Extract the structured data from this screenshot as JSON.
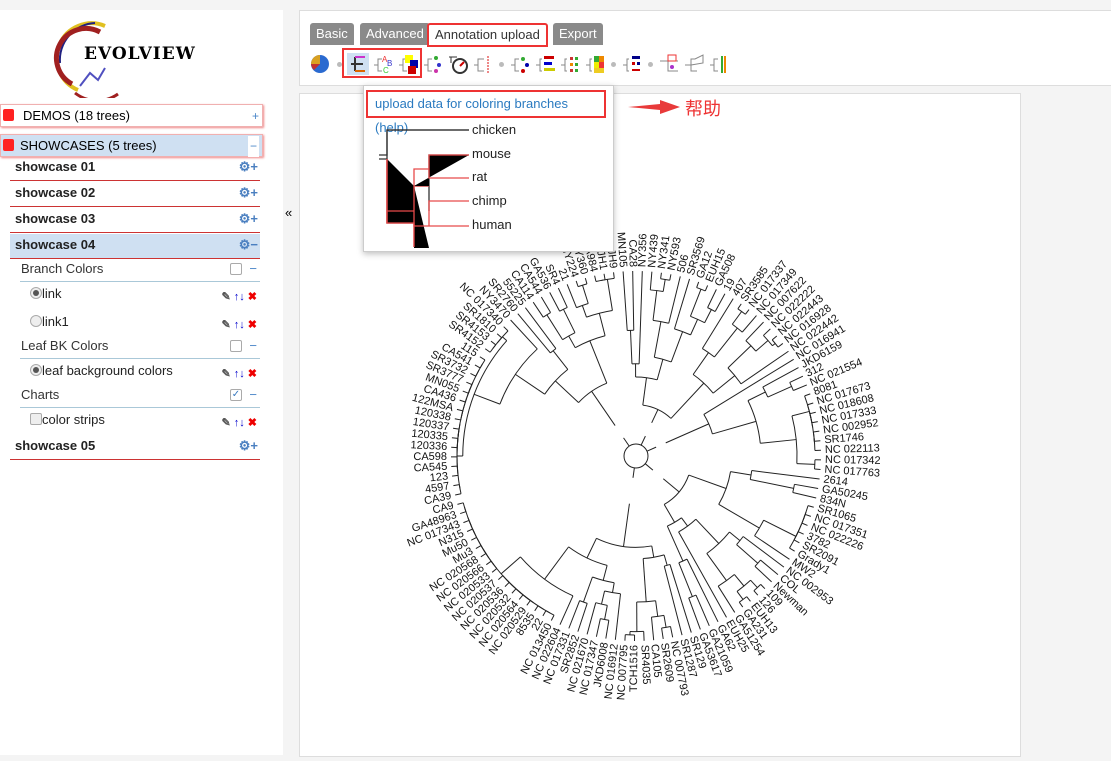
{
  "logo": {
    "text": "EVOLVIEW"
  },
  "sidebar": {
    "groups": [
      {
        "label": "DEMOS (18 trees)",
        "toggle": "+"
      },
      {
        "label": "SHOWCASES (5 trees)",
        "toggle": "−"
      }
    ],
    "showcases": [
      "showcase 01",
      "showcase 02",
      "showcase 03",
      "showcase 04",
      "showcase 05"
    ],
    "sections": [
      {
        "label": "Branch Colors",
        "checked": false,
        "items": [
          {
            "label": "link",
            "selected": true
          },
          {
            "label": "link1",
            "selected": false
          }
        ]
      },
      {
        "label": "Leaf BK Colors",
        "checked": false,
        "items": [
          {
            "label": "leaf background colors",
            "selected": true
          }
        ]
      },
      {
        "label": "Charts",
        "checked": true,
        "items": [
          {
            "label": "color strips",
            "selected": false
          }
        ]
      }
    ],
    "collapse_icon": "«"
  },
  "tabs": [
    {
      "label": "Basic"
    },
    {
      "label": "Advanced"
    },
    {
      "label": "Annotation upload",
      "active": true
    },
    {
      "label": "Export"
    }
  ],
  "popup": {
    "help_link": "upload data for coloring branches (help)",
    "leaves": [
      "chicken",
      "mouse",
      "rat",
      "chimp",
      "human"
    ],
    "branch_color": "#e84a4a"
  },
  "annotation": {
    "text": "帮助",
    "color": "#e83a3a"
  },
  "tree": {
    "leaves": [
      "MN105",
      "CA28",
      "NY356",
      "NY439",
      "NY341",
      "NY593",
      "506",
      "SR3569",
      "GA12",
      "EUH15",
      "GA508",
      "19",
      "407",
      "SR3585",
      "NC 017337",
      "NC 017349",
      "NC 007622",
      "NC 022222",
      "NC 022443",
      "NC 016928",
      "NC 022442",
      "NC 016941",
      "JKD6159",
      "312",
      "NC 021554",
      "8081",
      "NC 017673",
      "NC 018608",
      "NC 017333",
      "NC 002952",
      "SR1746",
      "NC 022113",
      "NC 017342",
      "NC 017763",
      "2614",
      "GA50245",
      "834N",
      "SR1065",
      "NC 017351",
      "NC 022226",
      "3782",
      "SR2091",
      "Grady1",
      "MW2",
      "NC 002953",
      "COL",
      "Newman",
      "109",
      "126",
      "EUH13",
      "GA231",
      "GA51254",
      "EUH25",
      "GA62",
      "GA21059",
      "GA53617",
      "SR129",
      "SR1287",
      "NC 007793",
      "SR2609",
      "CA105",
      "SR4035",
      "TCH1516",
      "NC 007795",
      "NC 016912",
      "JKD6008",
      "NC 017347",
      "NC 021670",
      "SR2852",
      "NC 017331",
      "NC 022604",
      "NC 013450",
      "22",
      "8535",
      "NC 020529",
      "NC 020564",
      "NC 020532",
      "NC 020536",
      "NC 020537",
      "NC 020533",
      "NC 020566",
      "NC 020568",
      "Mu3",
      "Mu50",
      "N315",
      "NC 017343",
      "GA48963",
      "CA9",
      "CA39",
      "4597",
      "123",
      "CA545",
      "CA598",
      "120336",
      "120335",
      "120337",
      "120338",
      "122MSA",
      "CA436",
      "MN055",
      "SR3777",
      "SR3732",
      "CA541",
      "115",
      "SR4152",
      "SR4153",
      "SR1810",
      "NC 017340",
      "NY3470",
      "SR2760",
      "55225",
      "CA114",
      "CA544",
      "GA536",
      "SR4",
      "21",
      "NY224",
      "NY360",
      "GA984",
      "JH1",
      "JH9"
    ]
  }
}
